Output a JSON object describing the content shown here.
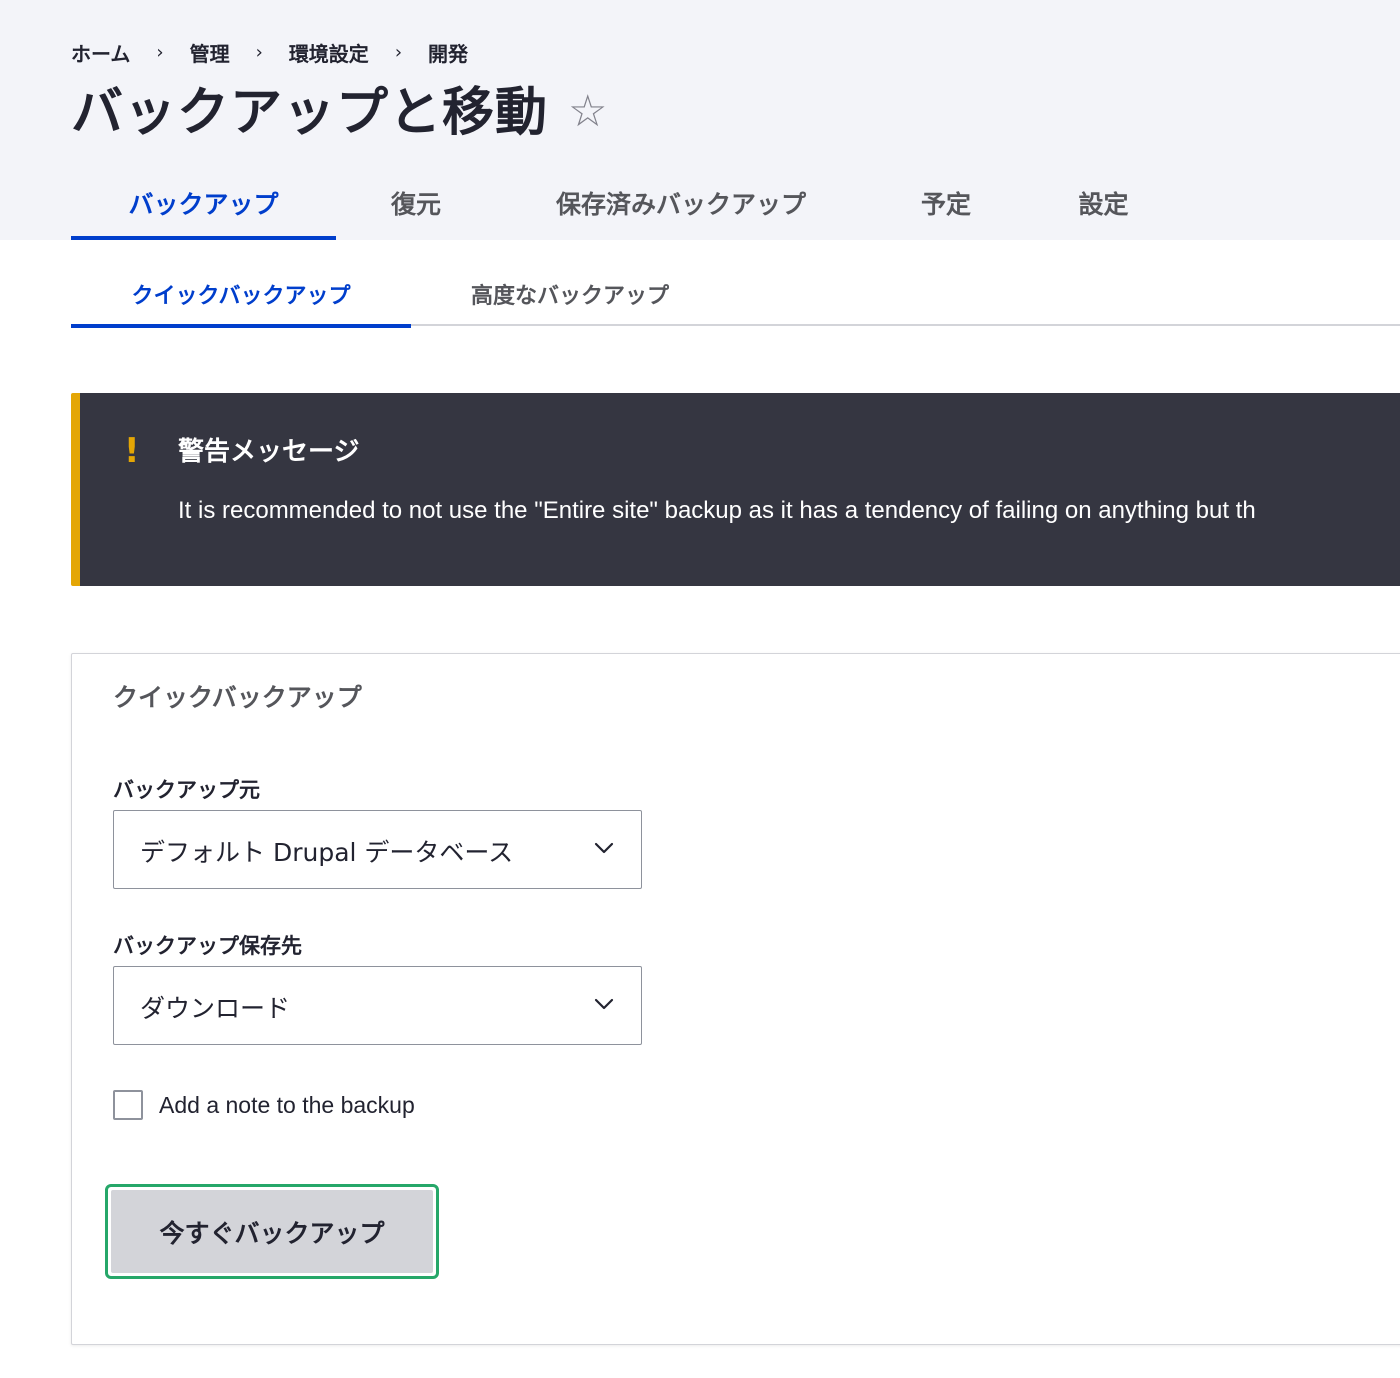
{
  "breadcrumb": {
    "items": [
      "ホーム",
      "管理",
      "環境設定",
      "開発"
    ],
    "separator": "›"
  },
  "header": {
    "title": "バックアップと移動",
    "favorite_icon": "☆"
  },
  "primary_tabs": [
    {
      "label": "バックアップ",
      "active": true
    },
    {
      "label": "復元",
      "active": false
    },
    {
      "label": "保存済みバックアップ",
      "active": false
    },
    {
      "label": "予定",
      "active": false
    },
    {
      "label": "設定",
      "active": false
    }
  ],
  "secondary_tabs": [
    {
      "label": "クイックバックアップ",
      "active": true
    },
    {
      "label": "高度なバックアップ",
      "active": false
    }
  ],
  "warning": {
    "icon": "!",
    "title": "警告メッセージ",
    "text": "It is recommended to not use the \"Entire site\" backup as it has a tendency of failing on anything but th"
  },
  "form": {
    "legend": "クイックバックアップ",
    "source": {
      "label": "バックアップ元",
      "value": "デフォルト Drupal データベース"
    },
    "destination": {
      "label": "バックアップ保存先",
      "value": "ダウンロード"
    },
    "note_checkbox": {
      "label": "Add a note to the backup",
      "checked": false
    },
    "submit_label": "今すぐバックアップ"
  },
  "colors": {
    "accent": "#003ecc",
    "warning": "#e4a605",
    "focus": "#26a769",
    "header_bg": "#f3f4f9",
    "warning_bg": "#353641"
  }
}
